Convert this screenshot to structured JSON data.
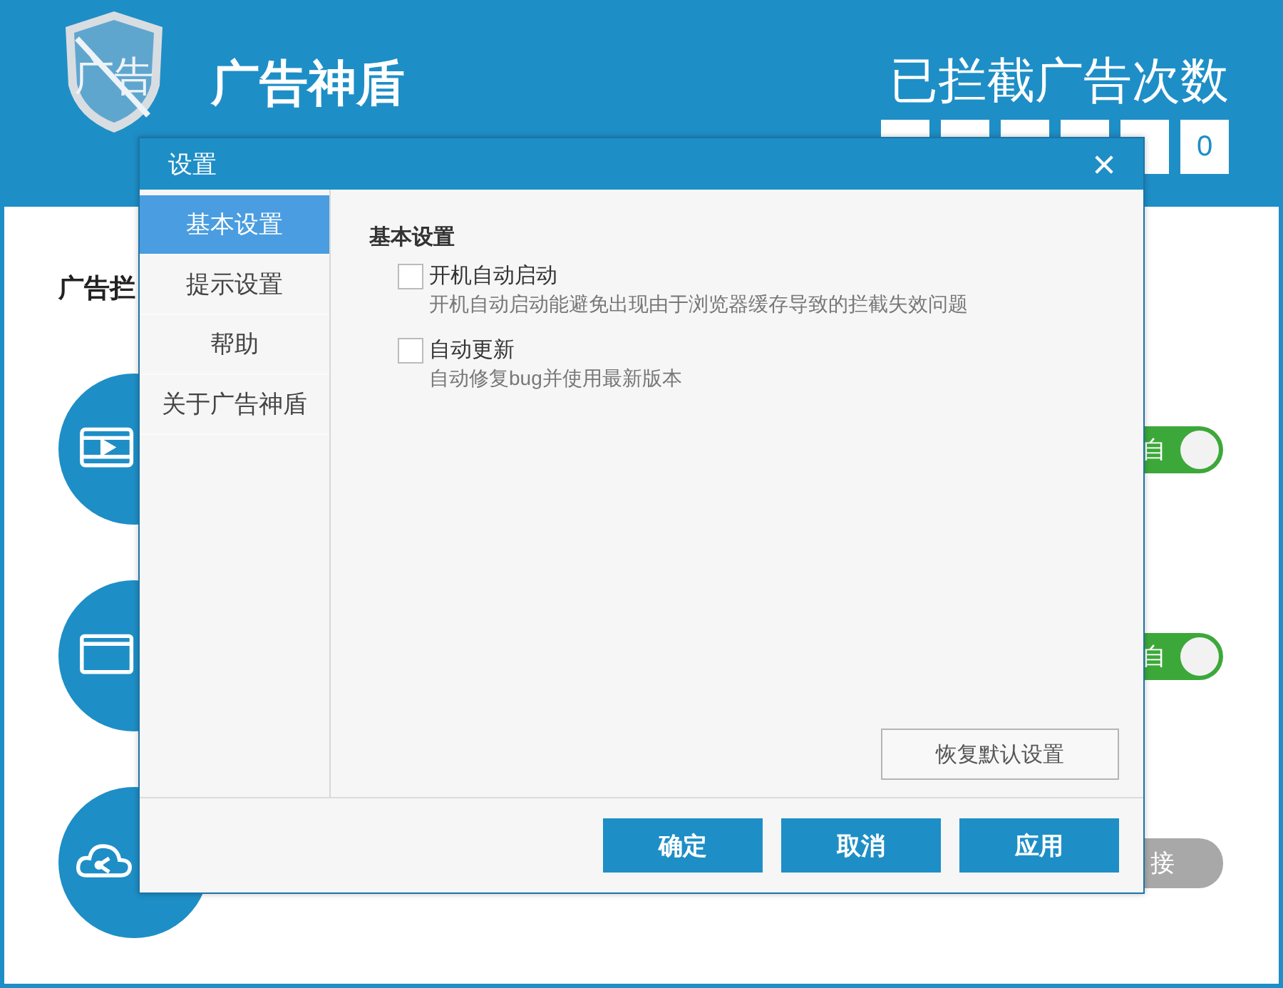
{
  "app": {
    "logo_text": "广告",
    "title": "广告神盾"
  },
  "counter": {
    "label": "已拦截广告次数",
    "digits": [
      {
        "kind": "covered"
      },
      {
        "kind": "covered"
      },
      {
        "kind": "covered"
      },
      {
        "kind": "covered"
      },
      {
        "kind": "covered"
      },
      {
        "kind": "digit",
        "value": "0"
      }
    ]
  },
  "section_label": "广告拦",
  "features": [
    {
      "kind": "toggle",
      "on": true,
      "label": "自"
    },
    {
      "kind": "toggle",
      "on": true,
      "label": "自"
    },
    {
      "kind": "button",
      "label": "接",
      "disabled": true
    }
  ],
  "dialog": {
    "title": "设置",
    "nav": [
      {
        "label": "基本设置",
        "selected": true
      },
      {
        "label": "提示设置",
        "selected": false
      },
      {
        "label": "帮助",
        "selected": false
      },
      {
        "label": "关于广告神盾",
        "selected": false
      }
    ],
    "section_title": "基本设置",
    "options": [
      {
        "label": "开机自动启动",
        "description": "开机自动启动能避免出现由于浏览器缓存导致的拦截失效问题",
        "checked": false
      },
      {
        "label": "自动更新",
        "description": "自动修复bug并使用最新版本",
        "checked": false
      }
    ],
    "restore_button": "恢复默认设置",
    "buttons": [
      "确定",
      "取消",
      "应用"
    ]
  }
}
